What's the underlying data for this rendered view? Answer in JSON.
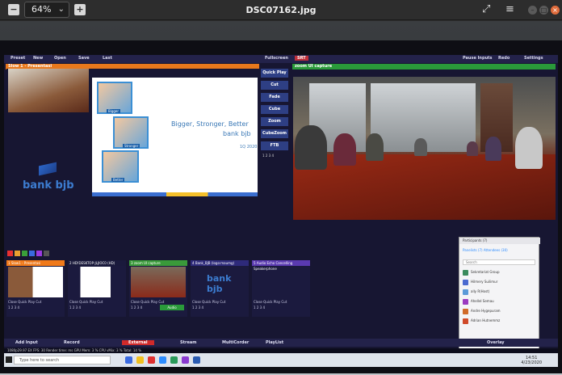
{
  "viewer": {
    "zoom_label": "64%",
    "file_title": "DSC07162.jpg",
    "add_icon": "plus-icon",
    "minus_icon": "minus-icon"
  },
  "vmix": {
    "menu": [
      "Preset",
      "New",
      "Open",
      "Save",
      "Last"
    ],
    "menu_right": [
      "Fullscreen",
      "SRT",
      "Pause Inputs",
      "Redo",
      "Settings"
    ],
    "preview_header": "Slow 1 - Presentasi",
    "output_header": "zoom UI capture",
    "slide_line1": "Bigger, Stronger, Better",
    "slide_line2": "bank bjb",
    "slide_date": "1Q 2020",
    "kid_labels": [
      "Bigger",
      "Stronger",
      "Better"
    ],
    "brand": "bank bjb",
    "transition_buttons": [
      "Quick Play",
      "Cut",
      "Fade",
      "Cube",
      "Zoom",
      "CubeZoom",
      "FTB"
    ],
    "transition_numbers": "1  2  3  4",
    "inputs": [
      {
        "num": "1",
        "name": "Slow1 - Presentasi",
        "color": "#f07a1a"
      },
      {
        "num": "2",
        "name": "HD!DESKTOP-JLJIOC0 (HD)",
        "color": "#1a1a3c"
      },
      {
        "num": "3",
        "name": "zoom UI capture",
        "color": "#3a9a3a"
      },
      {
        "num": "4",
        "name": "Bank_BJB (logo:maumg)",
        "color": "#2e2a7a"
      },
      {
        "num": "5",
        "name": "Audio Echo Cancelling Speakerphone",
        "color": "#5a3ab0"
      }
    ],
    "input_controls": "Close   Quick Play   Cut",
    "input_numbers": "1   2   3   4",
    "audio_label": "Audio",
    "bottom": [
      "Add Input",
      "Record",
      "External",
      "Stream",
      "MultiCorder",
      "PlayList",
      "Overlay"
    ],
    "status": "1080p29.97   EX   FPS: 30   Render time:   ms   GPU Mem: 3 %   CPU vMix: 3 %   Total: 14 %"
  },
  "zoom": {
    "title": "Participants (7)",
    "tabs": "Panelists (7)      Attendees (30)",
    "search_placeholder": "Search",
    "participants": [
      {
        "name": "Sekretariat Group",
        "color": "#3a8a5c"
      },
      {
        "name": "Hilmery Suilimur",
        "color": "#4a6ad0"
      },
      {
        "name": "ally R(Host)",
        "color": "#5a9ad8"
      },
      {
        "name": "Ahellel Semau",
        "color": "#9a3ac0"
      },
      {
        "name": "Andre Hygepuram",
        "color": "#d06a2a"
      },
      {
        "name": "Adrian Hutnemmz",
        "color": "#d04a2a"
      }
    ],
    "leave": "Leave All Panels"
  },
  "taskbar": {
    "search_text": "Type here to search",
    "time": "14:51",
    "date": "4/23/2020"
  }
}
